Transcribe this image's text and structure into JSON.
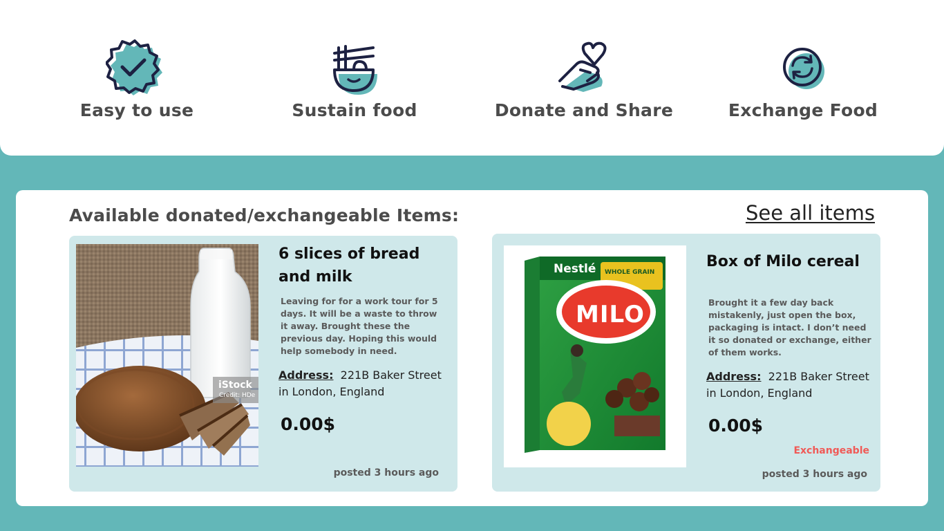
{
  "features": [
    {
      "label": "Easy to use",
      "icon": "verified-badge-icon"
    },
    {
      "label": "Sustain food",
      "icon": "noodle-bowl-icon"
    },
    {
      "label": "Donate and Share",
      "icon": "hand-heart-icon"
    },
    {
      "label": "Exchange Food",
      "icon": "exchange-cycle-icon"
    }
  ],
  "items_section": {
    "heading": "Available donated/exchangeable Items:",
    "see_all_label": "See all items",
    "items": [
      {
        "title": "6 slices of bread and milk",
        "description": "Leaving for for a work tour for 5 days. It will be a waste to throw it away. Brought these the previous day. Hoping this would help somebody in need.",
        "address_label": "Address:",
        "address": "221B Baker Street in London, England",
        "price": "0.00$",
        "posted": "posted 3 hours ago",
        "image_watermark": "iStock",
        "image_credit": "Credit: HDe"
      },
      {
        "title": "Box of Milo cereal",
        "description": "Brought it a few day back mistakenly, just open the box, packaging is intact. I don’t need it so donated or exchange, either of them works.",
        "address_label": "Address:",
        "address": "221B Baker Street in London, England",
        "price": "0.00$",
        "status": "Exchangeable",
        "posted": "posted 3 hours ago",
        "box_brand": "Nestlé",
        "box_tag": "WHOLE GRAIN",
        "box_name": "MILO"
      }
    ]
  },
  "colors": {
    "teal": "#63b7b8",
    "card_bg": "#cfe8ea",
    "icon_dark": "#1d2142",
    "exchangeable": "#f05a57"
  }
}
